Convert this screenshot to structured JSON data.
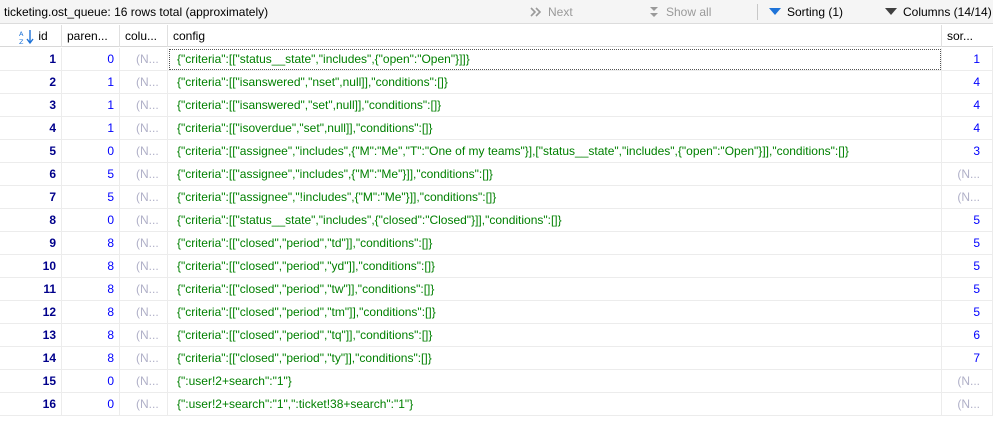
{
  "toolbar": {
    "title": "ticketing.ost_queue: 16 rows total (approximately)",
    "next_label": "Next",
    "showall_label": "Show all",
    "sorting_label": "Sorting (1)",
    "columns_label": "Columns (14/14)"
  },
  "columns": [
    "id",
    "paren...",
    "colu...",
    "config",
    "sor..."
  ],
  "rows": [
    {
      "id": "1",
      "parent": "0",
      "col": "(N...",
      "config": "{\"criteria\":[[\"status__state\",\"includes\",{\"open\":\"Open\"}]]}",
      "sort": "1"
    },
    {
      "id": "2",
      "parent": "1",
      "col": "(N...",
      "config": "{\"criteria\":[[\"isanswered\",\"nset\",null]],\"conditions\":[]}",
      "sort": "4"
    },
    {
      "id": "3",
      "parent": "1",
      "col": "(N...",
      "config": "{\"criteria\":[[\"isanswered\",\"set\",null]],\"conditions\":[]}",
      "sort": "4"
    },
    {
      "id": "4",
      "parent": "1",
      "col": "(N...",
      "config": "{\"criteria\":[[\"isoverdue\",\"set\",null]],\"conditions\":[]}",
      "sort": "4"
    },
    {
      "id": "5",
      "parent": "0",
      "col": "(N...",
      "config": "{\"criteria\":[[\"assignee\",\"includes\",{\"M\":\"Me\",\"T\":\"One of my teams\"}],[\"status__state\",\"includes\",{\"open\":\"Open\"}]],\"conditions\":[]}",
      "sort": "3"
    },
    {
      "id": "6",
      "parent": "5",
      "col": "(N...",
      "config": "{\"criteria\":[[\"assignee\",\"includes\",{\"M\":\"Me\"}]],\"conditions\":[]}",
      "sort": "(N..."
    },
    {
      "id": "7",
      "parent": "5",
      "col": "(N...",
      "config": "{\"criteria\":[[\"assignee\",\"!includes\",{\"M\":\"Me\"}]],\"conditions\":[]}",
      "sort": "(N..."
    },
    {
      "id": "8",
      "parent": "0",
      "col": "(N...",
      "config": "{\"criteria\":[[\"status__state\",\"includes\",{\"closed\":\"Closed\"}]],\"conditions\":[]}",
      "sort": "5"
    },
    {
      "id": "9",
      "parent": "8",
      "col": "(N...",
      "config": "{\"criteria\":[[\"closed\",\"period\",\"td\"]],\"conditions\":[]}",
      "sort": "5"
    },
    {
      "id": "10",
      "parent": "8",
      "col": "(N...",
      "config": "{\"criteria\":[[\"closed\",\"period\",\"yd\"]],\"conditions\":[]}",
      "sort": "5"
    },
    {
      "id": "11",
      "parent": "8",
      "col": "(N...",
      "config": "{\"criteria\":[[\"closed\",\"period\",\"tw\"]],\"conditions\":[]}",
      "sort": "5"
    },
    {
      "id": "12",
      "parent": "8",
      "col": "(N...",
      "config": "{\"criteria\":[[\"closed\",\"period\",\"tm\"]],\"conditions\":[]}",
      "sort": "5"
    },
    {
      "id": "13",
      "parent": "8",
      "col": "(N...",
      "config": "{\"criteria\":[[\"closed\",\"period\",\"tq\"]],\"conditions\":[]}",
      "sort": "6"
    },
    {
      "id": "14",
      "parent": "8",
      "col": "(N...",
      "config": "{\"criteria\":[[\"closed\",\"period\",\"ty\"]],\"conditions\":[]}",
      "sort": "7"
    },
    {
      "id": "15",
      "parent": "0",
      "col": "(N...",
      "config": "{\":user!2+search\":\"1\"}",
      "sort": "(N..."
    },
    {
      "id": "16",
      "parent": "0",
      "col": "(N...",
      "config": "{\":user!2+search\":\"1\",\":ticket!38+search\":\"1\"}",
      "sort": "(N..."
    }
  ],
  "colors": {
    "id": "#00008b",
    "number": "#0000ff",
    "json": "#008000",
    "null": "#b0b0c8",
    "accent": "#1e73d8"
  },
  "icons": {
    "next": "next-arrow-icon",
    "showall": "double-down-icon",
    "sorting": "filter-triangle-icon",
    "columns": "columns-triangle-icon",
    "sort_az": "sort-az-icon"
  }
}
